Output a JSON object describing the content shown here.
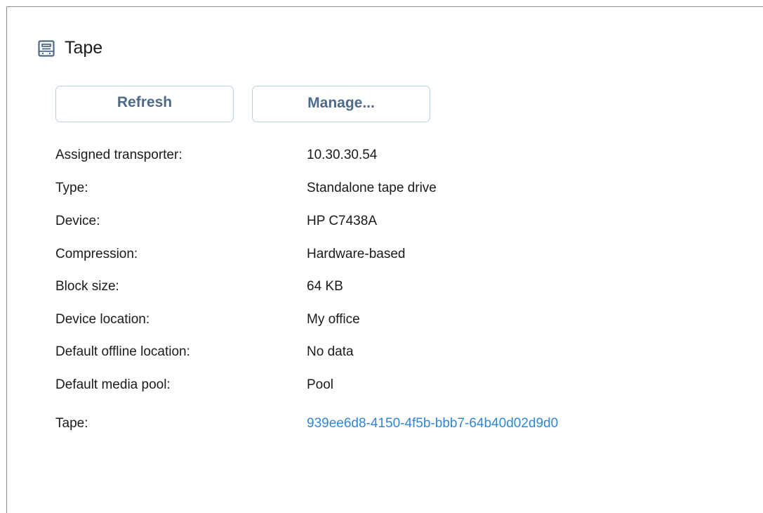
{
  "header": {
    "title": "Tape",
    "icon": "tape-icon"
  },
  "toolbar": {
    "refresh_label": "Refresh",
    "manage_label": "Manage..."
  },
  "properties": [
    {
      "label": "Assigned transporter:",
      "value": "10.30.30.54"
    },
    {
      "label": "Type:",
      "value": "Standalone tape drive"
    },
    {
      "label": "Device:",
      "value": "HP C7438A"
    },
    {
      "label": "Compression:",
      "value": "Hardware-based"
    },
    {
      "label": "Block size:",
      "value": "64 KB"
    },
    {
      "label": "Device location:",
      "value": "My office"
    },
    {
      "label": "Default offline location:",
      "value": "No data"
    },
    {
      "label": "Default media pool:",
      "value": "Pool"
    },
    {
      "label": "Tape:",
      "value": "939ee6d8-4150-4f5b-bbb7-64b40d02d9d0",
      "is_link": true
    }
  ],
  "colors": {
    "button_text": "#4e6a89",
    "button_border": "#b9cfe4",
    "link": "#2f86d6",
    "icon": "#4e6a89"
  }
}
